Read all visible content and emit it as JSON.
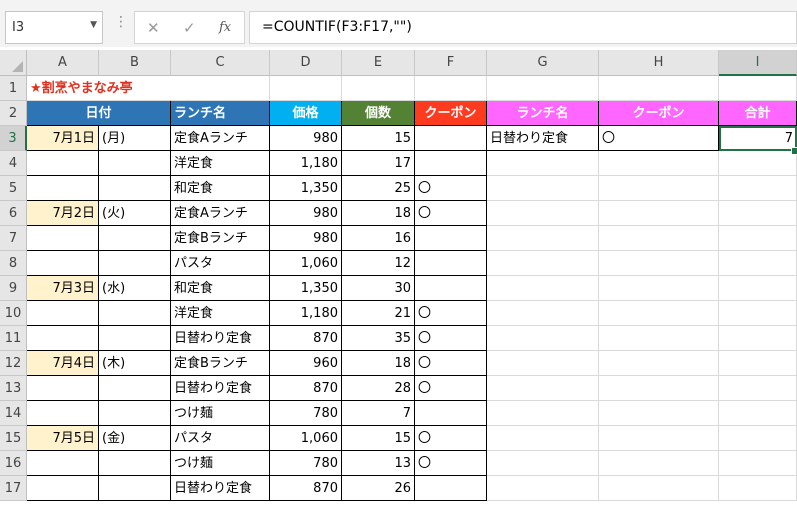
{
  "formula_bar": {
    "name_box": "I3",
    "cancel_icon": "✕",
    "enter_icon": "✓",
    "fx_label": "fx",
    "formula": "=COUNTIF(F3:F17,\"\")"
  },
  "columns": [
    "A",
    "B",
    "C",
    "D",
    "E",
    "F",
    "G",
    "H",
    "I"
  ],
  "rows": [
    "1",
    "2",
    "3",
    "4",
    "5",
    "6",
    "7",
    "8",
    "9",
    "10",
    "11",
    "12",
    "13",
    "14",
    "15",
    "16",
    "17"
  ],
  "selected_cell": "I3",
  "title": "★割烹やまなみ亭",
  "table_headers": {
    "date": "日付",
    "lunch": "ランチ名",
    "price": "価格",
    "count": "個数",
    "coupon": "クーポン"
  },
  "criteria_headers": {
    "lunch": "ランチ名",
    "coupon": "クーポン",
    "total": "合計"
  },
  "criteria_values": {
    "lunch": "日替わり定食",
    "coupon": "〇",
    "total": "7"
  },
  "data_rows": [
    {
      "date": "7月1日",
      "dow": "(月)",
      "lunch": "定食Aランチ",
      "price": "980",
      "count": "15",
      "coupon": ""
    },
    {
      "date": "",
      "dow": "",
      "lunch": "洋定食",
      "price": "1,180",
      "count": "17",
      "coupon": ""
    },
    {
      "date": "",
      "dow": "",
      "lunch": "和定食",
      "price": "1,350",
      "count": "25",
      "coupon": "〇"
    },
    {
      "date": "7月2日",
      "dow": "(火)",
      "lunch": "定食Aランチ",
      "price": "980",
      "count": "18",
      "coupon": "〇"
    },
    {
      "date": "",
      "dow": "",
      "lunch": "定食Bランチ",
      "price": "980",
      "count": "16",
      "coupon": ""
    },
    {
      "date": "",
      "dow": "",
      "lunch": "パスタ",
      "price": "1,060",
      "count": "12",
      "coupon": ""
    },
    {
      "date": "7月3日",
      "dow": "(水)",
      "lunch": "和定食",
      "price": "1,350",
      "count": "30",
      "coupon": ""
    },
    {
      "date": "",
      "dow": "",
      "lunch": "洋定食",
      "price": "1,180",
      "count": "21",
      "coupon": "〇"
    },
    {
      "date": "",
      "dow": "",
      "lunch": "日替わり定食",
      "price": "870",
      "count": "35",
      "coupon": "〇"
    },
    {
      "date": "7月4日",
      "dow": "(木)",
      "lunch": "定食Bランチ",
      "price": "960",
      "count": "18",
      "coupon": "〇"
    },
    {
      "date": "",
      "dow": "",
      "lunch": "日替わり定食",
      "price": "870",
      "count": "28",
      "coupon": "〇"
    },
    {
      "date": "",
      "dow": "",
      "lunch": "つけ麺",
      "price": "780",
      "count": "7",
      "coupon": ""
    },
    {
      "date": "7月5日",
      "dow": "(金)",
      "lunch": "パスタ",
      "price": "1,060",
      "count": "15",
      "coupon": "〇"
    },
    {
      "date": "",
      "dow": "",
      "lunch": "つけ麺",
      "price": "780",
      "count": "13",
      "coupon": "〇"
    },
    {
      "date": "",
      "dow": "",
      "lunch": "日替わり定食",
      "price": "870",
      "count": "26",
      "coupon": ""
    }
  ],
  "colors": {
    "header_blue": "#2e75b6",
    "header_cyan": "#00b0f0",
    "header_green": "#548235",
    "header_red": "#ff3b1f",
    "header_pink": "#ff66ff",
    "date_fill": "#fff2cc",
    "title_red": "#e0301e",
    "selection_green": "#217346"
  }
}
